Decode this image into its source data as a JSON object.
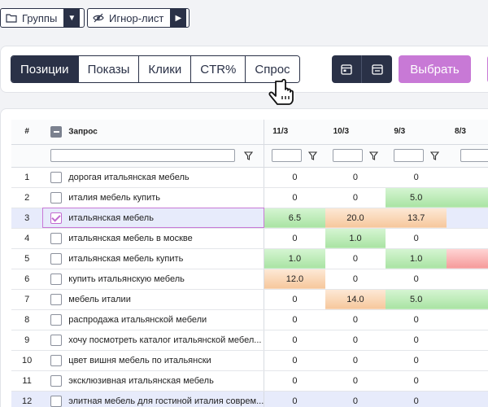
{
  "filters": {
    "groups_label": "Группы",
    "ignore_label": "Игнор-лист"
  },
  "toolbar": {
    "tabs": [
      "Позиции",
      "Показы",
      "Клики",
      "CTR%",
      "Спрос"
    ],
    "active_tab": "Позиции",
    "pick_label": "Выбрать",
    "accent_color": "#c879d6",
    "dark_color": "#2a3147"
  },
  "table": {
    "num_header": "#",
    "query_header": "Запрос",
    "date_headers": [
      "11/3",
      "10/3",
      "9/3",
      "8/3"
    ],
    "rows": [
      {
        "n": "1",
        "query": "дорогая итальянская мебель",
        "checked": false,
        "vals": [
          "0",
          "0",
          "0",
          ""
        ]
      },
      {
        "n": "2",
        "query": "италия мебель купить",
        "checked": false,
        "vals": [
          "0",
          "0",
          "5.0",
          ""
        ]
      },
      {
        "n": "3",
        "query": "итальянская мебель",
        "checked": true,
        "vals": [
          "6.5",
          "20.0",
          "13.7",
          ""
        ]
      },
      {
        "n": "4",
        "query": "итальянская мебель в москве",
        "checked": false,
        "vals": [
          "0",
          "1.0",
          "0",
          ""
        ]
      },
      {
        "n": "5",
        "query": "итальянская мебель купить",
        "checked": false,
        "vals": [
          "1.0",
          "0",
          "1.0",
          ""
        ]
      },
      {
        "n": "6",
        "query": "купить итальянскую мебель",
        "checked": false,
        "vals": [
          "12.0",
          "0",
          "0",
          ""
        ]
      },
      {
        "n": "7",
        "query": "мебель италии",
        "checked": false,
        "vals": [
          "0",
          "14.0",
          "5.0",
          ""
        ]
      },
      {
        "n": "8",
        "query": "распродажа итальянской мебели",
        "checked": false,
        "vals": [
          "0",
          "0",
          "0",
          ""
        ]
      },
      {
        "n": "9",
        "query": "хочу посмотреть каталог итальянской мебел...",
        "checked": false,
        "vals": [
          "0",
          "0",
          "0",
          ""
        ]
      },
      {
        "n": "10",
        "query": "цвет вишня мебель по итальянски",
        "checked": false,
        "vals": [
          "0",
          "0",
          "0",
          ""
        ]
      },
      {
        "n": "11",
        "query": "эксклюзивная итальянская мебель",
        "checked": false,
        "vals": [
          "0",
          "0",
          "0",
          ""
        ]
      },
      {
        "n": "12",
        "query": "элитная мебель для гостиной италия соврем...",
        "checked": false,
        "vals": [
          "0",
          "0",
          "0",
          ""
        ]
      }
    ],
    "cell_colors": {
      "green": "#a9e3a3",
      "orange": "#f6c79c",
      "red": "#f59a9a",
      "selected_row": "#e7ebfb"
    }
  }
}
